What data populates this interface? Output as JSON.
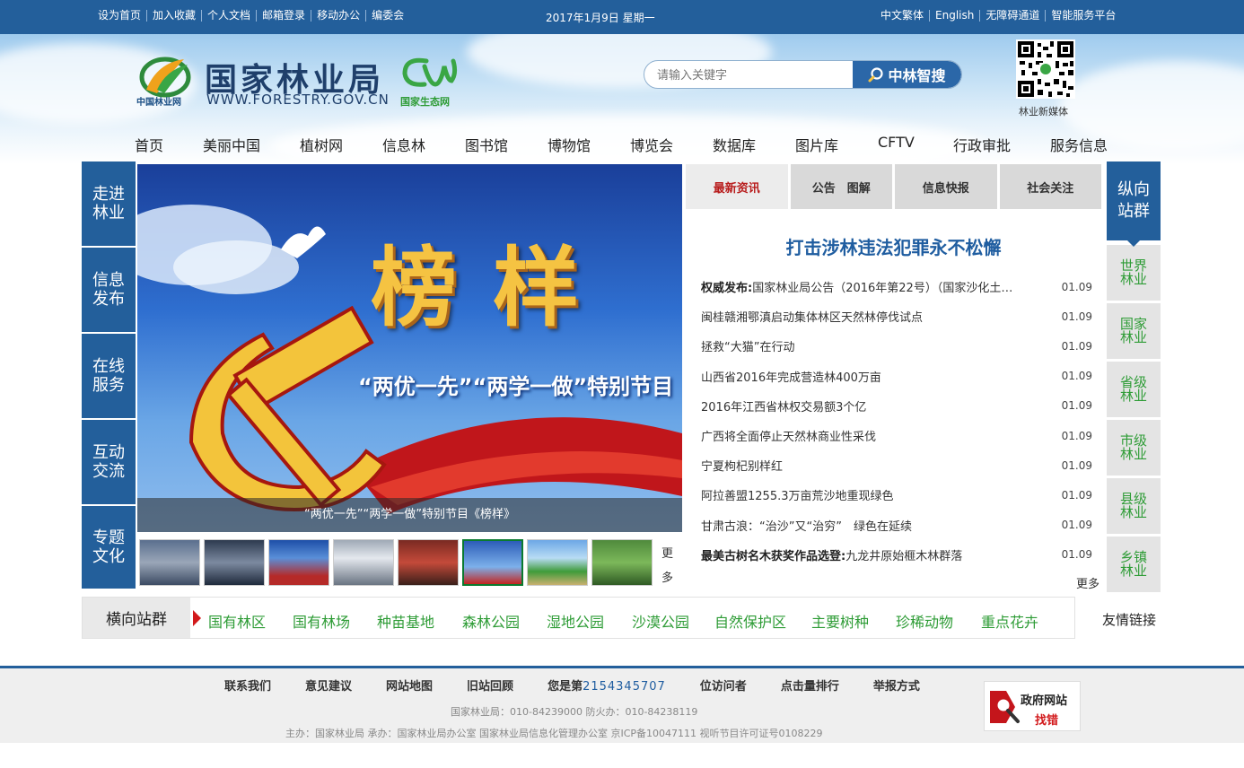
{
  "topbar": {
    "links": [
      "设为首页",
      "加入收藏",
      "个人文档",
      "邮箱登录",
      "移动办公",
      "编委会"
    ],
    "date": "2017年1月9日  星期一",
    "right_links": [
      "中文繁体",
      "English",
      "无障碍通道",
      "智能服务平台"
    ]
  },
  "header": {
    "logo_small": "中国林业网",
    "title": "国家林业局",
    "url": "WWW.FORESTRY.GOV.CN",
    "eco_label": "国家生态网",
    "search_placeholder": "请输入关键字",
    "search_button": "中林智搜",
    "qr_label": "林业新媒体"
  },
  "nav": [
    "首页",
    "美丽中国",
    "植树网",
    "信息林",
    "图书馆",
    "博物馆",
    "博览会",
    "数据库",
    "图片库",
    "CFTV",
    "行政审批",
    "服务信息"
  ],
  "left_sidebar": [
    "走进\n林业",
    "信息\n发布",
    "在线\n服务",
    "互动\n交流",
    "专题\n文化"
  ],
  "slider": {
    "big_text": "榜样",
    "sub_text": "“两优一先”“两学一做”特别节目",
    "caption": "“两优一先”“两学一做”特别节目《榜样》",
    "more": "更多"
  },
  "news": {
    "tabs": [
      "最新资讯",
      "公告　图解",
      "信息快报",
      "社会关注"
    ],
    "headline": "打击涉林违法犯罪永不松懈",
    "items": [
      {
        "prefix": "权威发布:",
        "title": "国家林业局公告（2016年第22号）（国家沙化土…",
        "date": "01.09"
      },
      {
        "prefix": "",
        "title": "闽桂赣湘鄂滇启动集体林区天然林停伐试点",
        "date": "01.09"
      },
      {
        "prefix": "",
        "title": "拯救“大猫”在行动",
        "date": "01.09"
      },
      {
        "prefix": "",
        "title": "山西省2016年完成营造林400万亩",
        "date": "01.09"
      },
      {
        "prefix": "",
        "title": "2016年江西省林权交易额3个亿",
        "date": "01.09"
      },
      {
        "prefix": "",
        "title": "广西将全面停止天然林商业性采伐",
        "date": "01.09"
      },
      {
        "prefix": "",
        "title": "宁夏枸杞别样红",
        "date": "01.09"
      },
      {
        "prefix": "",
        "title": "阿拉善盟1255.3万亩荒沙地重现绿色",
        "date": "01.09"
      },
      {
        "prefix": "",
        "title": "甘肃古浪：“治沙”又“治穷”　绿色在延续",
        "date": "01.09"
      },
      {
        "prefix": "最美古树名木获奖作品选登:",
        "title": "九龙井原始榧木林群落",
        "date": "01.09"
      }
    ],
    "more": "更多"
  },
  "right_sidebar": {
    "head": "纵向\n站群",
    "items": [
      "世界\n林业",
      "国家\n林业",
      "省级\n林业",
      "市级\n林业",
      "县级\n林业",
      "乡镇\n林业"
    ]
  },
  "hgroup": {
    "label": "横向站群",
    "links": [
      "国有林区",
      "国有林场",
      "种苗基地",
      "森林公园",
      "湿地公园",
      "沙漠公园",
      "自然保护区",
      "主要树种",
      "珍稀动物",
      "重点花卉"
    ],
    "friends": "友情链接"
  },
  "footer": {
    "links": [
      "联系我们",
      "意见建议",
      "网站地图",
      "旧站回顾"
    ],
    "visitor_prefix": "您是第",
    "visitor_count": "2154345707",
    "visitor_suffix": "位访问者",
    "links2": [
      "点击量排行",
      "举报方式"
    ],
    "line1": "国家林业局：010-84239000  防火办：010-84238119",
    "line2": "主办：国家林业局  承办：国家林业局办公室  国家林业局信息化管理办公室  京ICP备10047111  视听节目许可证号0108229",
    "badge1": "政府网站",
    "badge2": "找错"
  },
  "colors": {
    "primary": "#235f9b",
    "accent_red": "#b81c1c",
    "green": "#2e9c36"
  }
}
